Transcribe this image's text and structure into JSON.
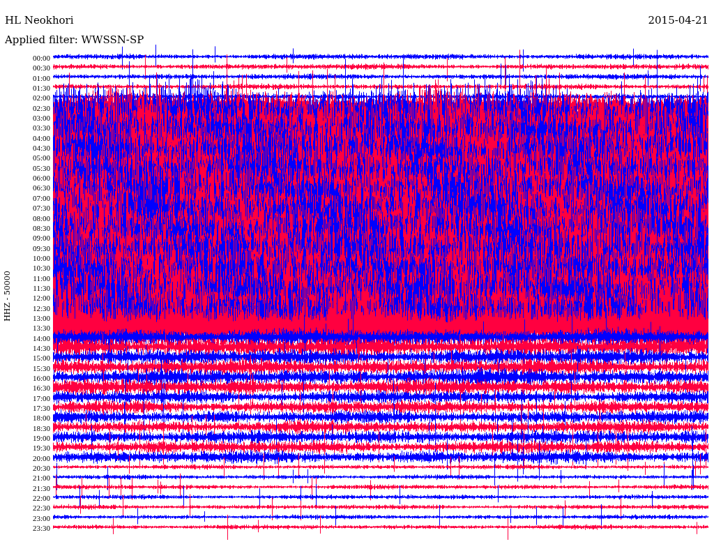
{
  "station": "HL Neokhori",
  "date": "2015-04-21",
  "filter": "Applied filter: WWSSN-SP",
  "axis_label": "HHZ - 50000",
  "time_labels": [
    "00:00",
    "00:30",
    "01:00",
    "01:30",
    "02:00",
    "02:30",
    "03:00",
    "03:30",
    "04:00",
    "04:30",
    "05:00",
    "05:30",
    "06:00",
    "06:30",
    "07:00",
    "07:30",
    "08:00",
    "08:30",
    "09:00",
    "09:30",
    "10:00",
    "10:30",
    "11:00",
    "11:30",
    "12:00",
    "12:30",
    "13:00",
    "13:30",
    "14:00",
    "14:30",
    "15:00",
    "15:30",
    "16:00",
    "16:30",
    "17:00",
    "17:30",
    "18:00",
    "18:30",
    "19:00",
    "19:30",
    "20:00",
    "20:30",
    "21:00",
    "21:30",
    "22:00",
    "22:30",
    "23:00",
    "23:30"
  ]
}
